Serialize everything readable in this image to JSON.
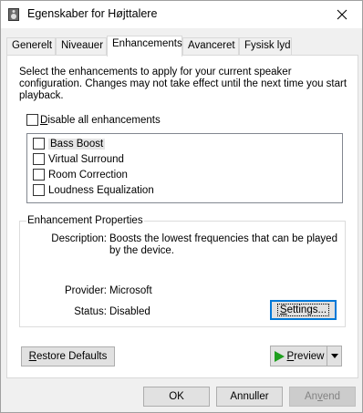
{
  "window": {
    "title": "Egenskaber for Højttalere",
    "close_icon": "close-icon",
    "title_icon": "speaker-icon"
  },
  "tabs": [
    {
      "label": "Generelt",
      "active": false
    },
    {
      "label": "Niveauer",
      "active": false
    },
    {
      "label": "Enhancements",
      "active": true
    },
    {
      "label": "Avanceret",
      "active": false
    },
    {
      "label": "Fysisk lyd",
      "active": false
    }
  ],
  "enhancements": {
    "description": "Select the enhancements to apply for your current speaker configuration. Changes may not take effect until the next time you start playback.",
    "disable_all_label": "Disable all enhancements",
    "disable_all_checked": false,
    "items": [
      {
        "label": "Bass Boost",
        "checked": false,
        "selected": true
      },
      {
        "label": "Virtual Surround",
        "checked": false,
        "selected": false
      },
      {
        "label": "Room Correction",
        "checked": false,
        "selected": false
      },
      {
        "label": "Loudness Equalization",
        "checked": false,
        "selected": false
      }
    ]
  },
  "properties": {
    "group_title": "Enhancement Properties",
    "description_label": "Description:",
    "description_value": "Boosts the lowest frequencies that can be played by the device.",
    "provider_label": "Provider:",
    "provider_value": "Microsoft",
    "status_label": "Status:",
    "status_value": "Disabled",
    "settings_button": "Settings..."
  },
  "buttons": {
    "restore_defaults": "Restore Defaults",
    "preview": "Preview",
    "ok": "OK",
    "cancel": "Annuller",
    "apply": "Anvend"
  },
  "colors": {
    "play_icon": "#1e9e1e",
    "focus_border": "#0078d7"
  }
}
